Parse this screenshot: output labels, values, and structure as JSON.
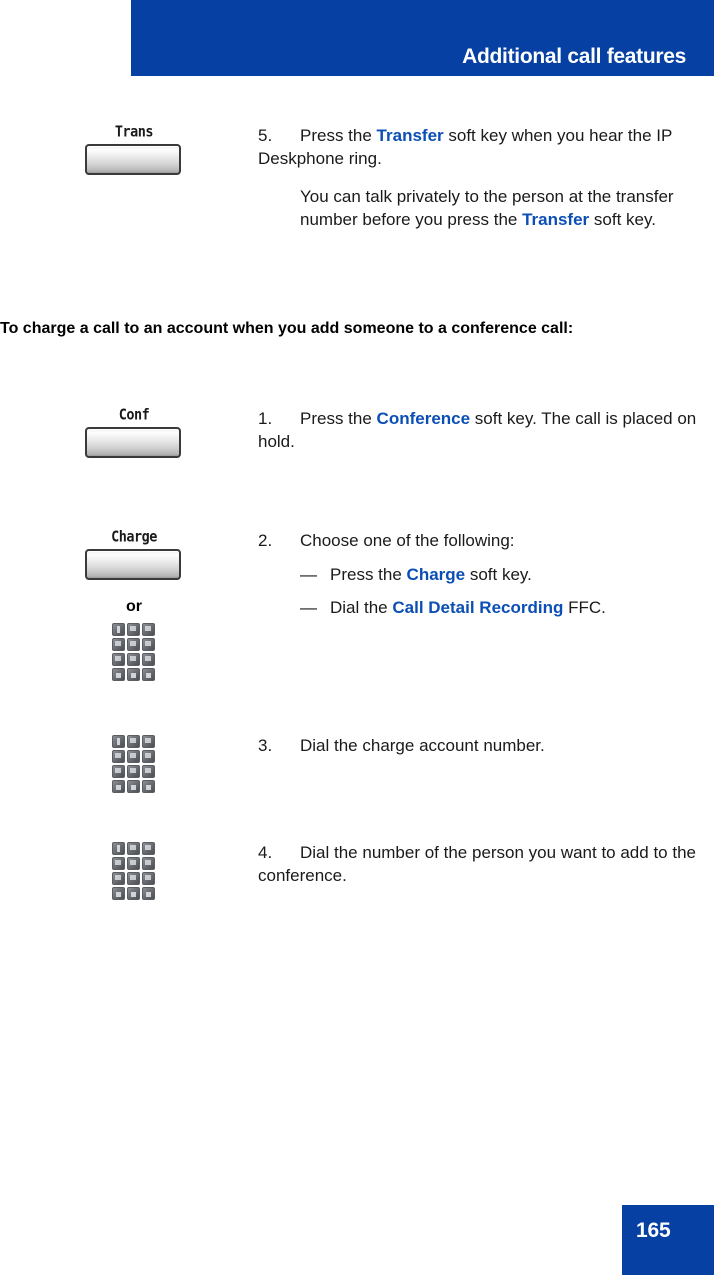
{
  "header": {
    "title": "Additional call features",
    "bar_color": "#0540a2"
  },
  "accent_color": "#0b4fb5",
  "steps_top": [
    {
      "number": "5.",
      "softkey_label": "Trans",
      "text_parts": [
        {
          "t": "Press the "
        },
        {
          "t": "Transfer",
          "hl": true
        },
        {
          "t": " soft key when you hear the IP Deskphone ring."
        }
      ],
      "note_parts": [
        {
          "t": "You can talk privately to the person at the transfer number before you press the "
        },
        {
          "t": "Transfer",
          "hl": true
        },
        {
          "t": " soft key."
        }
      ]
    }
  ],
  "section_heading": "To charge a call to an account when you add someone to a conference call:",
  "steps_bottom": [
    {
      "number": "1.",
      "softkey_label": "Conf",
      "text_parts": [
        {
          "t": "Press the "
        },
        {
          "t": "Conference",
          "hl": true
        },
        {
          "t": " soft key. The call is placed on hold."
        }
      ]
    },
    {
      "number": "2.",
      "softkey_label": "Charge",
      "or_label": "or",
      "text_parts": [
        {
          "t": "Choose one of the following:"
        }
      ],
      "dash_items": [
        {
          "mark": "—",
          "parts": [
            {
              "t": "Press the "
            },
            {
              "t": "Charge",
              "hl": true
            },
            {
              "t": " soft key."
            }
          ]
        },
        {
          "mark": "—",
          "parts": [
            {
              "t": "Dial the "
            },
            {
              "t": "Call Detail Recording",
              "hl": true
            },
            {
              "t": " FFC."
            }
          ]
        }
      ]
    },
    {
      "number": "3.",
      "text_parts": [
        {
          "t": "Dial the charge account number."
        }
      ]
    },
    {
      "number": "4.",
      "text_parts": [
        {
          "t": "Dial the number of the person you want to add to the conference."
        }
      ]
    }
  ],
  "icons": {
    "keypad": "dialpad-icon",
    "softkey": "soft-key-button-icon"
  },
  "footer": {
    "page_number": "165",
    "box_color": "#0540a2"
  }
}
